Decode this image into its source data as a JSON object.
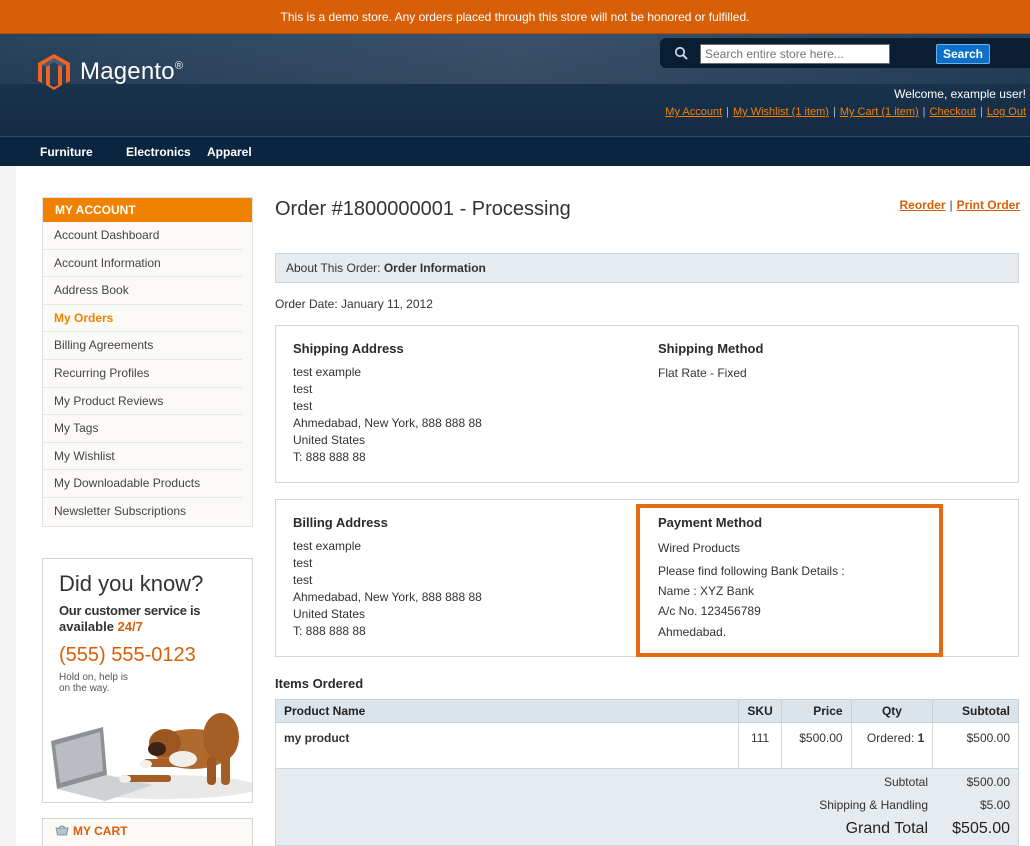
{
  "notice": "This is a demo store. Any orders placed through this store will not be honored or fulfilled.",
  "brand": {
    "name": "Magento",
    "mark": "®",
    "color": "#f26322"
  },
  "search": {
    "placeholder": "Search entire store here...",
    "button": "Search"
  },
  "header": {
    "welcome": "Welcome, example user!",
    "links": [
      "My Account",
      "My Wishlist (1 item)",
      "My Cart (1 item)",
      "Checkout",
      "Log Out"
    ]
  },
  "nav": [
    "Furniture",
    "Electronics",
    "Apparel"
  ],
  "sidebar": {
    "title": "MY ACCOUNT",
    "items": [
      "Account Dashboard",
      "Account Information",
      "Address Book",
      "My Orders",
      "Billing Agreements",
      "Recurring Profiles",
      "My Product Reviews",
      "My Tags",
      "My Wishlist",
      "My Downloadable Products",
      "Newsletter Subscriptions"
    ],
    "active_index": 3
  },
  "promo": {
    "title": "Did you know?",
    "line1": "Our customer service is",
    "line2": "available ",
    "line2_highlight": "24/7",
    "phone": "(555) 555-0123",
    "hold1": "Hold on, help is",
    "hold2": "on the way."
  },
  "mini_cart": {
    "title": "MY CART"
  },
  "order": {
    "title": "Order #1800000001 - Processing",
    "reorder": "Reorder",
    "print": "Print Order",
    "sep": "|",
    "about_label": "About This Order:",
    "about_value": "Order Information",
    "date": "Order Date: January 11, 2012"
  },
  "shipping_address": {
    "title": "Shipping Address",
    "lines": [
      "test example",
      "test",
      "test",
      "Ahmedabad, New York, 888 888 88",
      "United States",
      "T: 888 888 88"
    ]
  },
  "shipping_method": {
    "title": "Shipping Method",
    "value": "Flat Rate - Fixed"
  },
  "billing_address": {
    "title": "Billing Address",
    "lines": [
      "test example",
      "test",
      "test",
      "Ahmedabad, New York, 888 888 88",
      "United States",
      "T: 888 888 88"
    ]
  },
  "payment_method": {
    "title": "Payment Method",
    "lines": [
      "Wired Products",
      "Please find following Bank Details :",
      "Name : XYZ Bank",
      "A/c No. 123456789",
      "Ahmedabad."
    ]
  },
  "items": {
    "title": "Items Ordered",
    "headers": [
      "Product Name",
      "SKU",
      "Price",
      "Qty",
      "Subtotal"
    ],
    "rows": [
      {
        "name": "my product",
        "sku": "111",
        "price": "$500.00",
        "qty_label": "Ordered: ",
        "qty": "1",
        "subtotal": "$500.00"
      }
    ]
  },
  "totals": {
    "subtotal_label": "Subtotal",
    "subtotal": "$500.00",
    "shipping_label": "Shipping & Handling",
    "shipping": "$5.00",
    "grand_label": "Grand Total",
    "grand": "$505.00"
  }
}
